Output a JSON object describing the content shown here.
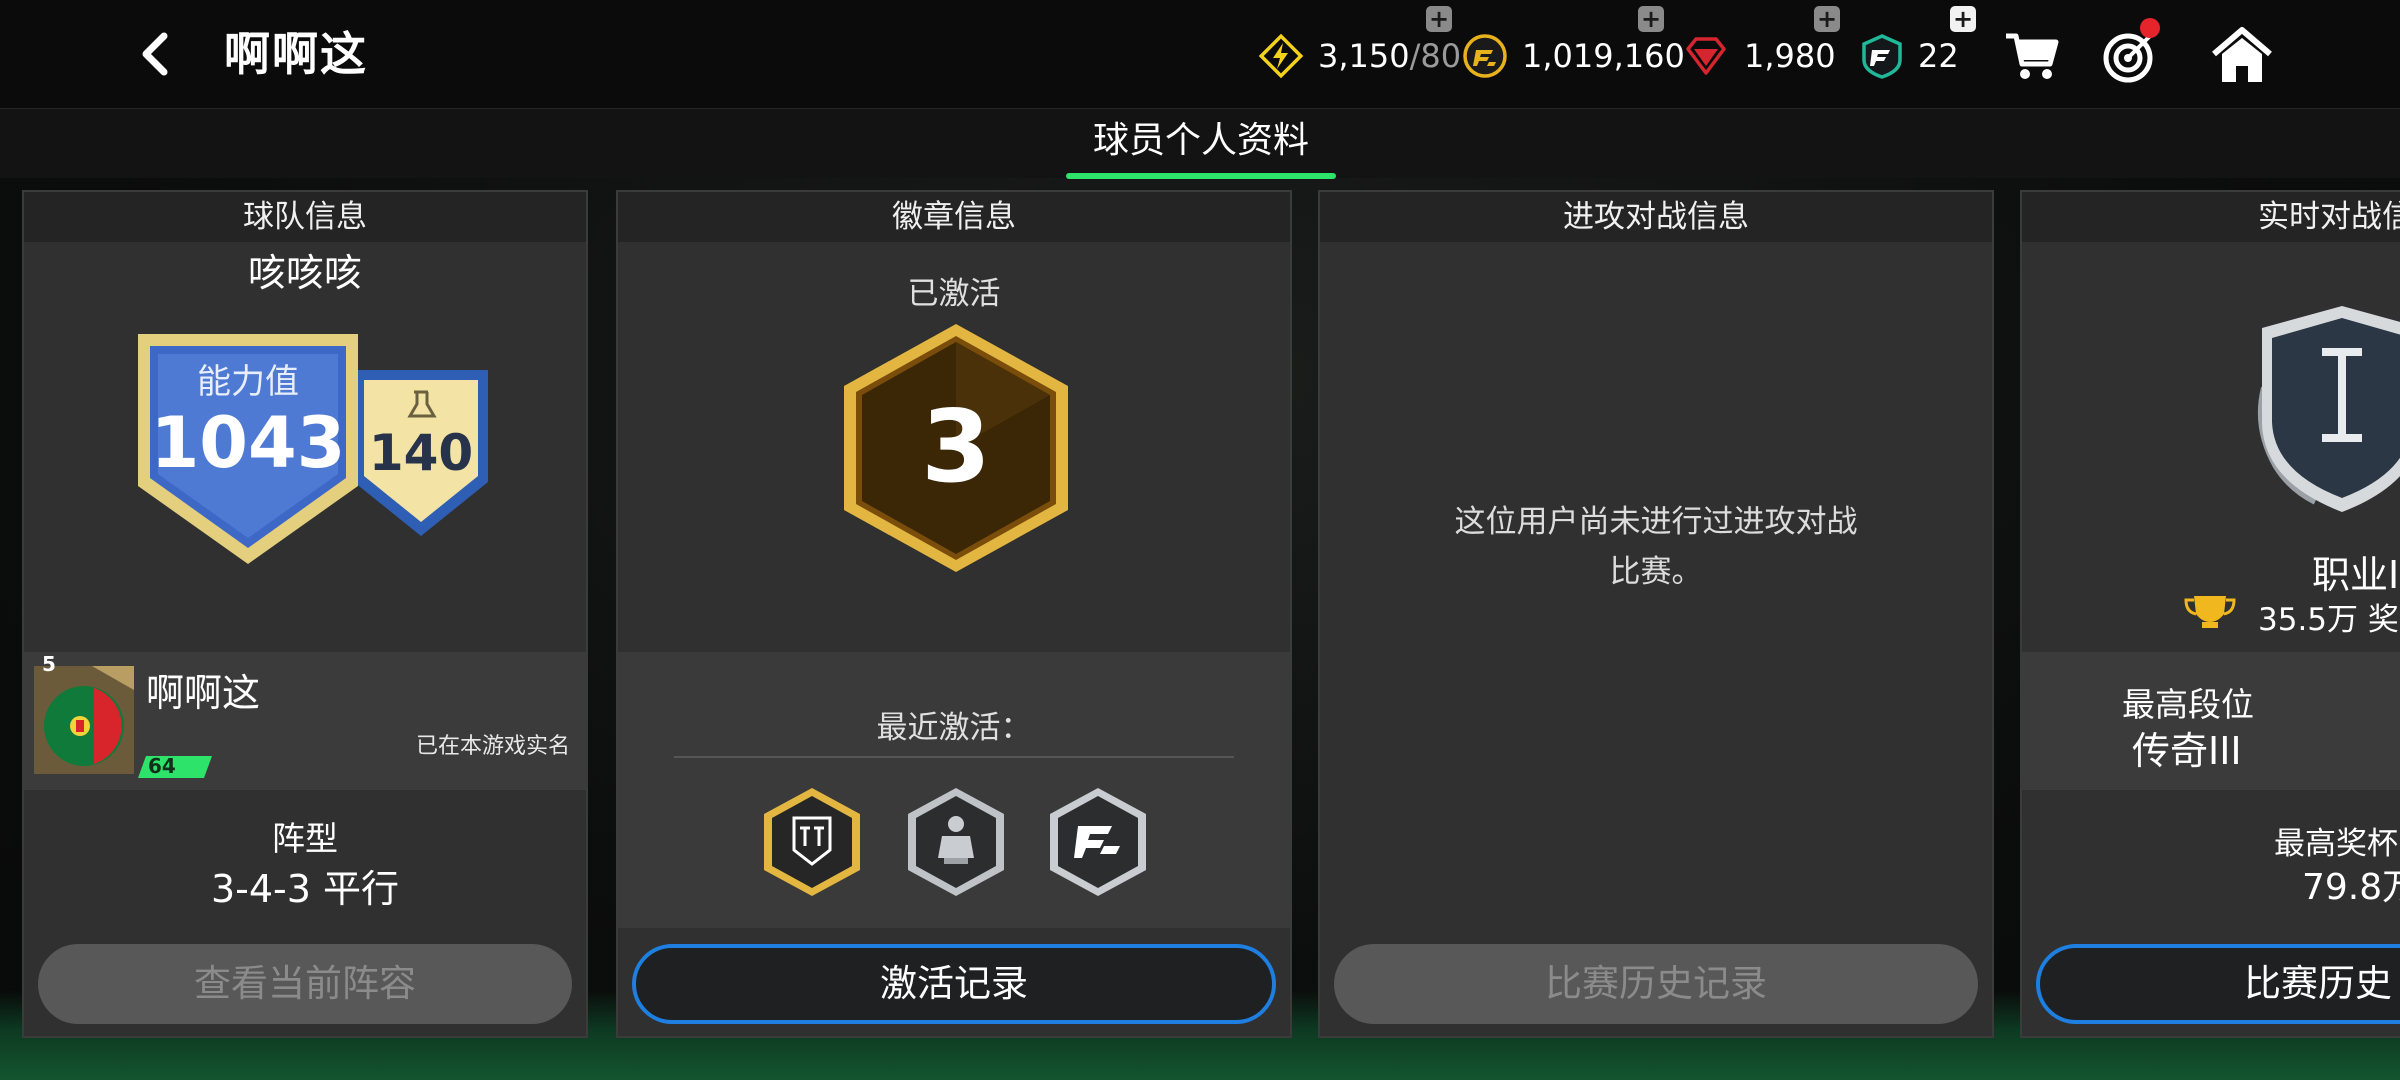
{
  "header": {
    "title": "啊啊这",
    "currencies": [
      {
        "name": "energy",
        "value": "3,150",
        "suffix": "/80",
        "icon": "lightning-icon",
        "color": "#f4d21b"
      },
      {
        "name": "coins",
        "value": "1,019,160",
        "icon": "fc-coin-icon",
        "color": "#e9b21d"
      },
      {
        "name": "gems",
        "value": "1,980",
        "icon": "gem-icon",
        "color": "#d6252e"
      },
      {
        "name": "tokens",
        "value": "22",
        "icon": "fc-token-icon",
        "color": "#1fb99a"
      }
    ],
    "plus_label": "+"
  },
  "tab": {
    "label": "球员个人资料",
    "accent": "#2ee36a"
  },
  "panels": {
    "team": {
      "title": "球队信息",
      "team_name": "咳咳咳",
      "power_label": "能力值",
      "power_value": "1043",
      "secondary_value": "140",
      "player_name": "啊啊这",
      "player_level": "5",
      "player_badge_value": "64",
      "verified_text": "已在本游戏实名",
      "formation_label": "阵型",
      "formation_value": "3-4-3 平行",
      "button": "查看当前阵容"
    },
    "badges": {
      "title": "徽章信息",
      "activated_label": "已激活",
      "activated_count": "3",
      "recent_label": "最近激活：",
      "recent_badges": [
        "toty-badge-icon",
        "trophy-badge-icon",
        "fc-badge-icon"
      ],
      "button": "激活记录"
    },
    "attack": {
      "title": "进攻对战信息",
      "empty_line1": "这位用户尚未进行过进攻对战",
      "empty_line2": "比赛。",
      "button": "比赛历史记录"
    },
    "live": {
      "title": "实时对战信",
      "rank_letter": "I",
      "rank_name": "职业I",
      "trophies": "35.5万 奖",
      "best_rank_label": "最高段位",
      "best_rank_value": "传奇III",
      "best_trophy_label": "最高奖杯",
      "best_trophy_value": "79.8万",
      "button": "比赛历史"
    }
  }
}
